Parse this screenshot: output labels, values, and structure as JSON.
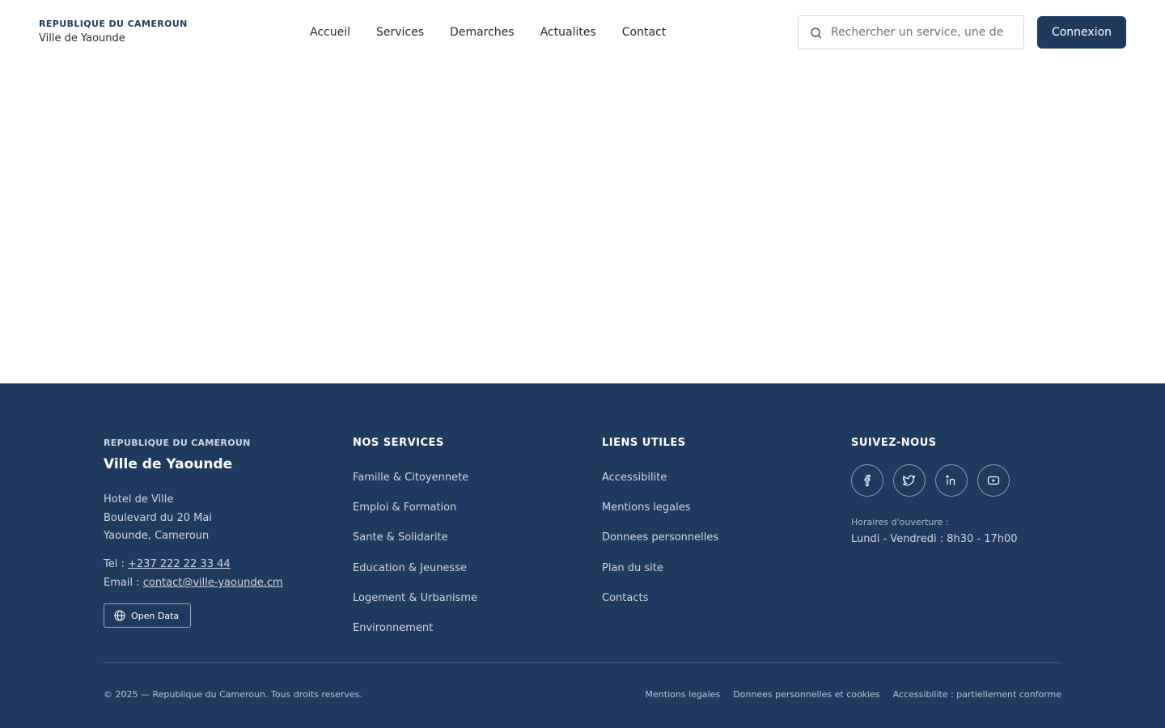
{
  "header": {
    "brand_top": "REPUBLIQUE DU CAMEROUN",
    "brand_sub": "Ville de Yaounde",
    "nav": [
      "Accueil",
      "Services",
      "Demarches",
      "Actualites",
      "Contact"
    ],
    "search_placeholder": "Rechercher un service, une demarche...",
    "search_icon": "search-icon",
    "login_label": "Connexion"
  },
  "footer": {
    "brand_top": "REPUBLIQUE DU CAMEROUN",
    "city": "Ville de Yaounde",
    "address": [
      "Hotel de Ville",
      "Boulevard du 20 Mai",
      "Yaounde, Cameroun"
    ],
    "tel_label": "Tel : ",
    "tel_value": "+237 222 22 33 44",
    "email_label": "Email : ",
    "email_value": "contact@ville-yaounde.cm",
    "open_data_label": "Open Data",
    "open_data_icon": "globe-icon",
    "services_heading": "NOS SERVICES",
    "services": [
      "Famille & Citoyennete",
      "Emploi & Formation",
      "Sante & Solidarite",
      "Education & Jeunesse",
      "Logement & Urbanisme",
      "Environnement"
    ],
    "links_heading": "LIENS UTILES",
    "links": [
      "Accessibilite",
      "Mentions legales",
      "Donnees personnelles",
      "Plan du site",
      "Contacts"
    ],
    "follow_heading": "SUIVEZ-NOUS",
    "socials": [
      "facebook-icon",
      "twitter-icon",
      "linkedin-icon",
      "youtube-icon"
    ],
    "hours_label": "Horaires d'ouverture :",
    "hours": "Lundi - Vendredi : 8h30 - 17h00",
    "copyright": "© 2025 — Republique du Cameroun. Tous droits reserves.",
    "legal": [
      "Mentions legales",
      "Donnees personnelles et cookies",
      "Accessibilite : partiellement conforme"
    ]
  },
  "colors": {
    "primary": "#1f3a5f",
    "background": "#ffffff"
  }
}
